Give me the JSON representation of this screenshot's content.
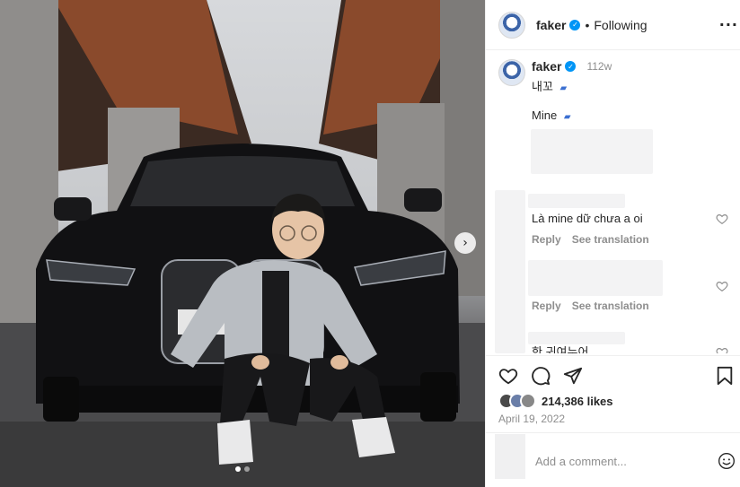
{
  "post": {
    "next_glyph": "›",
    "dots_count": 2
  },
  "header": {
    "username": "faker",
    "separator": "•",
    "follow_status": "Following",
    "more_glyph": "···"
  },
  "caption": {
    "username": "faker",
    "time_ago": "112w",
    "text_korean": "내꼬",
    "text_english": "Mine",
    "car_emoji": "🚗"
  },
  "comments": [
    {
      "text": "Là mine dữ chưa a oi",
      "reply_label": "Reply",
      "translate_label": "See translation"
    },
    {
      "text": "",
      "reply_label": "Reply",
      "translate_label": "See translation"
    },
    {
      "text": "한 귀여누어"
    }
  ],
  "actions": {
    "likes": "214,386 likes",
    "date": "April 19, 2022"
  },
  "add_comment": {
    "placeholder": "Add a comment..."
  },
  "colors": {
    "verified": "#0095f6",
    "secondary_text": "#8e8e8e",
    "primary_text": "#262626"
  }
}
